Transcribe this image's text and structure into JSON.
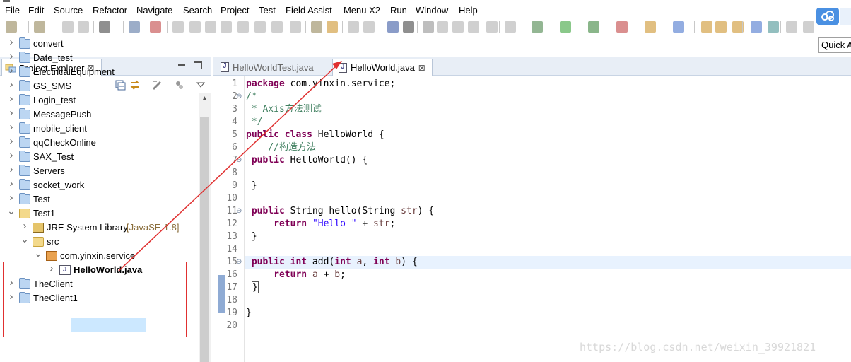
{
  "menubar": {
    "items": [
      "File",
      "Edit",
      "Source",
      "Refactor",
      "Navigate",
      "Search",
      "Project",
      "Test",
      "Field Assist",
      "Menu X2",
      "Run",
      "Window",
      "Help"
    ]
  },
  "toolbar": {
    "quick_access": "Quick A",
    "cloud_button": "cloud-icon"
  },
  "explorer": {
    "title": "Project Explorer",
    "close": "⊠",
    "tree": [
      {
        "label": "convert",
        "icon": "folder-icon",
        "expanded": false
      },
      {
        "label": "Date_test",
        "icon": "project-icon",
        "expanded": false
      },
      {
        "label": "ElectricalEquipment",
        "icon": "folder-icon",
        "expanded": false
      },
      {
        "label": "GS_SMS",
        "icon": "folder-icon",
        "expanded": false
      },
      {
        "label": "Login_test",
        "icon": "folder-icon",
        "expanded": false
      },
      {
        "label": "MessagePush",
        "icon": "folder-icon",
        "expanded": false
      },
      {
        "label": "mobile_client",
        "icon": "folder-icon",
        "expanded": false
      },
      {
        "label": "qqCheckOnline",
        "icon": "project-icon",
        "expanded": false
      },
      {
        "label": "SAX_Test",
        "icon": "folder-icon",
        "expanded": false
      },
      {
        "label": "Servers",
        "icon": "folder-icon",
        "expanded": false
      },
      {
        "label": "socket_work",
        "icon": "folder-icon",
        "expanded": false
      },
      {
        "label": "Test",
        "icon": "project-icon",
        "expanded": false
      },
      {
        "label": "Test1",
        "icon": "project-open-icon",
        "expanded": true
      },
      {
        "label": "JRE System Library",
        "decoration": "[JavaSE-1.8]",
        "icon": "library-icon",
        "expanded": false
      },
      {
        "label": "src",
        "icon": "source-folder-icon",
        "expanded": true
      },
      {
        "label": "com.yinxin.service",
        "icon": "package-icon",
        "expanded": true
      },
      {
        "label": "HelloWorld.java",
        "icon": "java-file-icon",
        "expanded": false,
        "selected": true
      },
      {
        "label": "TheClient",
        "icon": "project-icon",
        "expanded": false
      },
      {
        "label": "TheClient1",
        "icon": "project-icon",
        "expanded": false
      }
    ]
  },
  "editor": {
    "tabs": [
      {
        "label": "HelloWorldTest.java",
        "active": false
      },
      {
        "label": "HelloWorld.java",
        "active": true,
        "close": "⊠"
      }
    ],
    "lines": [
      {
        "n": "1",
        "html": "<span class='kw'>package</span> com.yinxin.service;"
      },
      {
        "n": "2",
        "fold": "⊖",
        "html": "<span class='cm'>/*</span>"
      },
      {
        "n": "3",
        "html": "<span class='cm'> * Axis方法测试</span>"
      },
      {
        "n": "4",
        "html": "<span class='cm'> */</span>"
      },
      {
        "n": "5",
        "html": "<span class='kw'>public</span> <span class='kw'>class</span> HelloWorld {"
      },
      {
        "n": "6",
        "html": "    <span class='cm'>//构造方法</span>"
      },
      {
        "n": "7",
        "fold": "⊖",
        "html": " <span class='kw'>public</span> HelloWorld() {"
      },
      {
        "n": "8",
        "html": ""
      },
      {
        "n": "9",
        "html": " }"
      },
      {
        "n": "10",
        "html": ""
      },
      {
        "n": "11",
        "fold": "⊖",
        "html": " <span class='kw'>public</span> String hello(String <span class='par'>str</span>) {"
      },
      {
        "n": "12",
        "html": "     <span class='kw'>return</span> <span class='str'>\"Hello \"</span> + <span class='par'>str</span>;"
      },
      {
        "n": "13",
        "html": " }"
      },
      {
        "n": "14",
        "html": ""
      },
      {
        "n": "15",
        "fold": "⊖",
        "html": " <span class='kw'>public</span> <span class='kw'>int</span> add(<span class='kw'>int</span> <span class='par'>a</span>, <span class='kw'>int</span> <span class='par'>b</span>) {"
      },
      {
        "n": "16",
        "html": "     <span class='kw'>return</span> <span class='par'>a</span> + <span class='par'>b</span>;"
      },
      {
        "n": "17",
        "html": " <span class='brk'>}</span>"
      },
      {
        "n": "18",
        "html": ""
      },
      {
        "n": "19",
        "html": "}"
      },
      {
        "n": "20",
        "html": ""
      }
    ]
  },
  "watermark": "https://blog.csdn.net/weixin_39921821"
}
